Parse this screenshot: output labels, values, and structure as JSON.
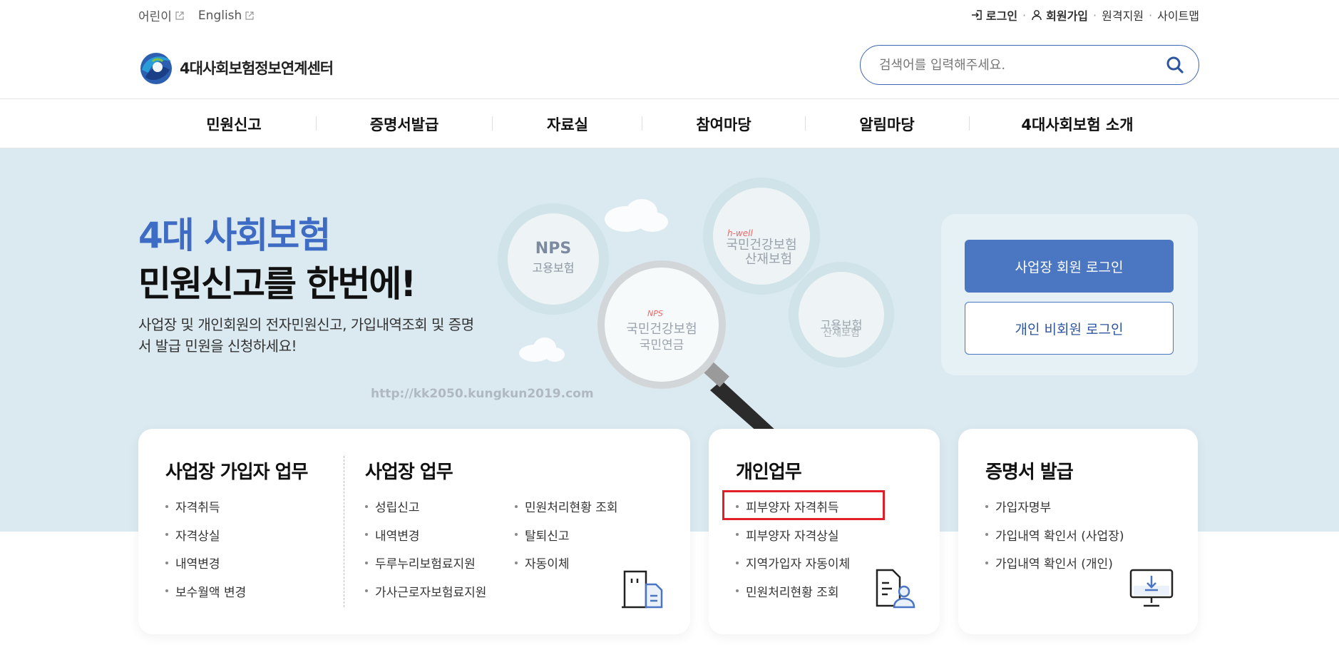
{
  "util": {
    "kids": "어린이",
    "english": "English",
    "login": "로그인",
    "join": "회원가입",
    "remote": "원격지원",
    "sitemap": "사이트맵"
  },
  "header": {
    "logo_text": "4대사회보험정보연계센터",
    "search_placeholder": "검색어를 입력해주세요."
  },
  "gnb": [
    "민원신고",
    "증명서발급",
    "자료실",
    "참여마당",
    "알림마당",
    "4대사회보험 소개"
  ],
  "hero": {
    "title1": "4대 사회보험",
    "title2": "민원신고를 한번에!",
    "desc": "사업장 및 개인회원의 전자민원신고, 가입내역조회 및 증명서 발급 민원을 신청하세요!",
    "watermark": "http://kk2050.kungkun2019.com",
    "illus": {
      "c1_top": "NPS",
      "c1_bot": "고용보험",
      "c2_brand": "h-well",
      "c2_l1": "국민건강보험",
      "c2_l2": "산재보험",
      "c3_l1": "NPS",
      "c3_l2": "국민건강보험",
      "c3_l3": "국민연금",
      "c4_l1": "고용보험",
      "c4_l2": "산재보험"
    }
  },
  "login": {
    "biz": "사업장 회원 로그인",
    "person": "개인 비회원 로그인"
  },
  "cards": {
    "subscriber": {
      "title": "사업장 가입자 업무",
      "items": [
        "자격취득",
        "자격상실",
        "내역변경",
        "보수월액 변경"
      ]
    },
    "workplace": {
      "title": "사업장 업무",
      "col1": [
        "성립신고",
        "내역변경",
        "두루누리보험료지원",
        "가사근로자보험료지원"
      ],
      "col2": [
        "민원처리현황 조회",
        "탈퇴신고",
        "자동이체"
      ]
    },
    "personal": {
      "title": "개인업무",
      "items": [
        "피부양자 자격취득",
        "피부양자 자격상실",
        "지역가입자 자동이체",
        "민원처리현황 조회"
      ]
    },
    "cert": {
      "title": "증명서 발급",
      "items": [
        "가입자명부",
        "가입내역 확인서 (사업장)",
        "가입내역 확인서 (개인)"
      ]
    }
  },
  "colors": {
    "accent": "#4a76c2",
    "title_blue": "#3e6bc4",
    "hero_bg": "#daeaf0",
    "highlight": "#e01f2a"
  }
}
